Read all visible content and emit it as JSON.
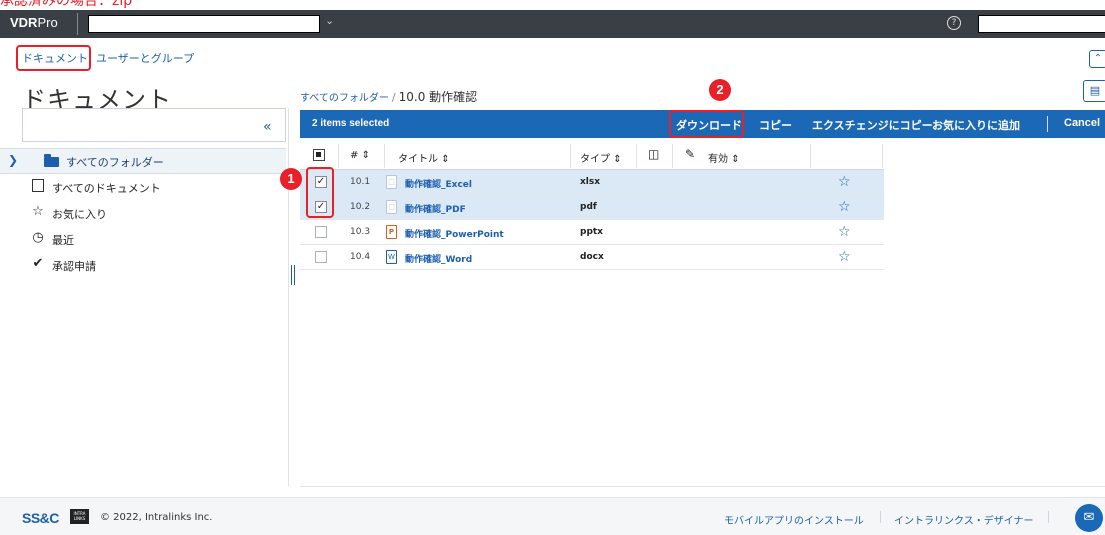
{
  "annotation_top": "承認済みの場合：zip",
  "header": {
    "brand_bold": "VDR",
    "brand_rest": "Pro",
    "help_icon": "?"
  },
  "tabs": [
    {
      "label": "ドキュメント"
    },
    {
      "label": "ユーザーとグループ"
    }
  ],
  "page_title": "ドキュメント",
  "breadcrumb": {
    "root": "すべてのフォルダー",
    "sep": "/",
    "current": "10.0 動作確認"
  },
  "sidebar": {
    "root": "すべてのフォルダー",
    "items": [
      {
        "label": "すべてのドキュメント",
        "icon": "document-icon"
      },
      {
        "label": "お気に入り",
        "icon": "star-icon"
      },
      {
        "label": "最近",
        "icon": "clock-icon"
      },
      {
        "label": "承認申請",
        "icon": "check-icon"
      }
    ]
  },
  "action_bar": {
    "selected": "2 items selected",
    "download": "ダウンロード",
    "copy": "コピー",
    "copy_exchange": "エクスチェンジにコピー",
    "favorite": "お気に入りに追加",
    "cancel": "Cancel"
  },
  "table": {
    "headers": {
      "num": "#",
      "title": "タイトル",
      "type": "タイプ",
      "valid": "有効",
      "sort": "⇕"
    },
    "rows": [
      {
        "num": "10.1",
        "title": "動作確認_Excel",
        "type": "xlsx",
        "selected": true,
        "icon": "excel-file-icon"
      },
      {
        "num": "10.2",
        "title": "動作確認_PDF",
        "type": "pdf",
        "selected": true,
        "icon": "pdf-file-icon"
      },
      {
        "num": "10.3",
        "title": "動作確認_PowerPoint",
        "type": "pptx",
        "selected": false,
        "icon": "powerpoint-file-icon"
      },
      {
        "num": "10.4",
        "title": "動作確認_Word",
        "type": "docx",
        "selected": false,
        "icon": "word-file-icon"
      }
    ]
  },
  "annotations": {
    "badge1": "1",
    "badge2": "2"
  },
  "footer": {
    "ssc": "SS&C",
    "intralinks": "INTRA LINKS",
    "copyright": "© 2022, Intralinks Inc.",
    "mobile": "モバイルアプリのインストール",
    "designer": "イントラリンクス・デザイナー"
  },
  "colors": {
    "accent": "#1a68b6",
    "annotation": "#e8202a",
    "header": "#3a3f45"
  }
}
